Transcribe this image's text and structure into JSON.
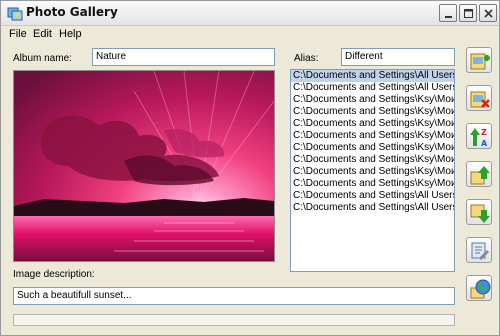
{
  "window": {
    "title": "Photo Gallery"
  },
  "menu": [
    "File",
    "Edit",
    "Help"
  ],
  "album": {
    "name_label": "Album name:",
    "name_value": "Nature",
    "alias_label": "Alias:",
    "alias_value": "Different"
  },
  "files": [
    "C:\\Documents and Settings\\All Users.WINDOWS",
    "C:\\Documents and Settings\\All Users.WINDOWS",
    "C:\\Documents and Settings\\Ksy\\Мои документы",
    "C:\\Documents and Settings\\Ksy\\Мои документы",
    "C:\\Documents and Settings\\Ksy\\Мои документы",
    "C:\\Documents and Settings\\Ksy\\Мои документы",
    "C:\\Documents and Settings\\Ksy\\Мои документы",
    "C:\\Documents and Settings\\Ksy\\Мои документы",
    "C:\\Documents and Settings\\Ksy\\Мои документы",
    "C:\\Documents and Settings\\Ksy\\Мои документы",
    "C:\\Documents and Settings\\All Users.WINDOWS",
    "C:\\Documents and Settings\\All Users.WINDOWS"
  ],
  "selected_index": 0,
  "description": {
    "label": "Image description:",
    "value": "Such a beautifull sunset..."
  },
  "toolbar": [
    "add-image-icon",
    "remove-image-icon",
    "sort-az-icon",
    "move-up-icon",
    "move-down-icon",
    "settings-icon",
    "globe-icon"
  ],
  "colors": {
    "sky_top": "#7a1040",
    "sun": "#ffe3f2",
    "water": "#e0106a",
    "add_green": "#2aa22a",
    "remove_red": "#d82020"
  }
}
